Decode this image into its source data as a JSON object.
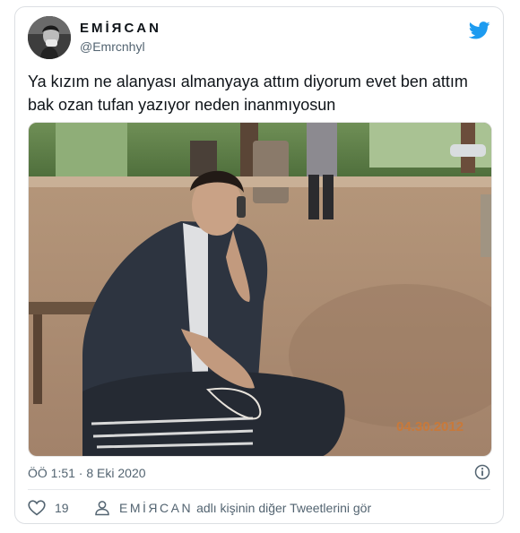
{
  "author": {
    "display_name": "EMİЯCAN",
    "handle": "@Emrcnhyl",
    "avatar": "avatar-photo-icon"
  },
  "tweet": {
    "text": "Ya kızım ne alanyası almanyaya attım diyorum evet ben attım bak ozan tufan yazıyor neden inanmıyosun",
    "photo": {
      "date_stamp": "04.30.2012"
    },
    "timestamp": "ÖÖ 1:51 · 8 Eki 2020"
  },
  "actions": {
    "like_count": "19",
    "profile_link_name": "EMİЯCAN",
    "profile_link_suffix": "adlı kişinin diğer Tweetlerini gör"
  },
  "colors": {
    "brand": "#1d9bf0",
    "text": "#0f1419",
    "secondary": "#536471",
    "photo_date": "#c8793a"
  },
  "icons": {
    "logo": "twitter-bird-icon",
    "info": "info-icon",
    "like": "heart-icon",
    "profile": "person-icon"
  }
}
